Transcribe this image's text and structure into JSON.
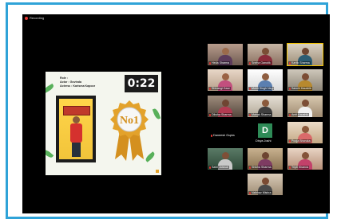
{
  "recording": {
    "label": "Recording"
  },
  "slide": {
    "heading": "Role :",
    "actor_line": "Actor : Govinda",
    "actress_line": "Actress : Karisma Kapoor",
    "timer": "0:22",
    "badge_text": "No1",
    "colors": {
      "badge_gold": "#e3a22b",
      "badge_ribbon": "#d4901f",
      "badge_center": "#f7f7f7"
    }
  },
  "participants": [
    {
      "name": "Heda Sharma",
      "active": false
    },
    {
      "name": "Sneha Ganutik",
      "active": false
    },
    {
      "name": "Kartik Sharma",
      "active": true
    },
    {
      "name": "Shivangi Gaur",
      "active": false
    },
    {
      "name": "Mohit Singh Negi",
      "active": false
    },
    {
      "name": "Sanchi Kaushik",
      "active": false
    },
    {
      "name": "Diksha Sharma",
      "active": false
    },
    {
      "name": "Mahak Sharma",
      "active": false
    },
    {
      "name": "Amit Kaushik",
      "active": false
    },
    {
      "name": "Daneesh Gupta",
      "active": false
    },
    {
      "name": "Divya Joshi",
      "initial": "D",
      "active": false
    },
    {
      "name": "Pooja Bhoruka",
      "active": false
    },
    {
      "name": "Sahil Jaiswal",
      "active": false
    },
    {
      "name": "Shikha Sharma",
      "active": false
    },
    {
      "name": "Tripti Khanna",
      "active": false
    },
    {
      "name": "Vaibhav Mishra",
      "active": false
    }
  ]
}
